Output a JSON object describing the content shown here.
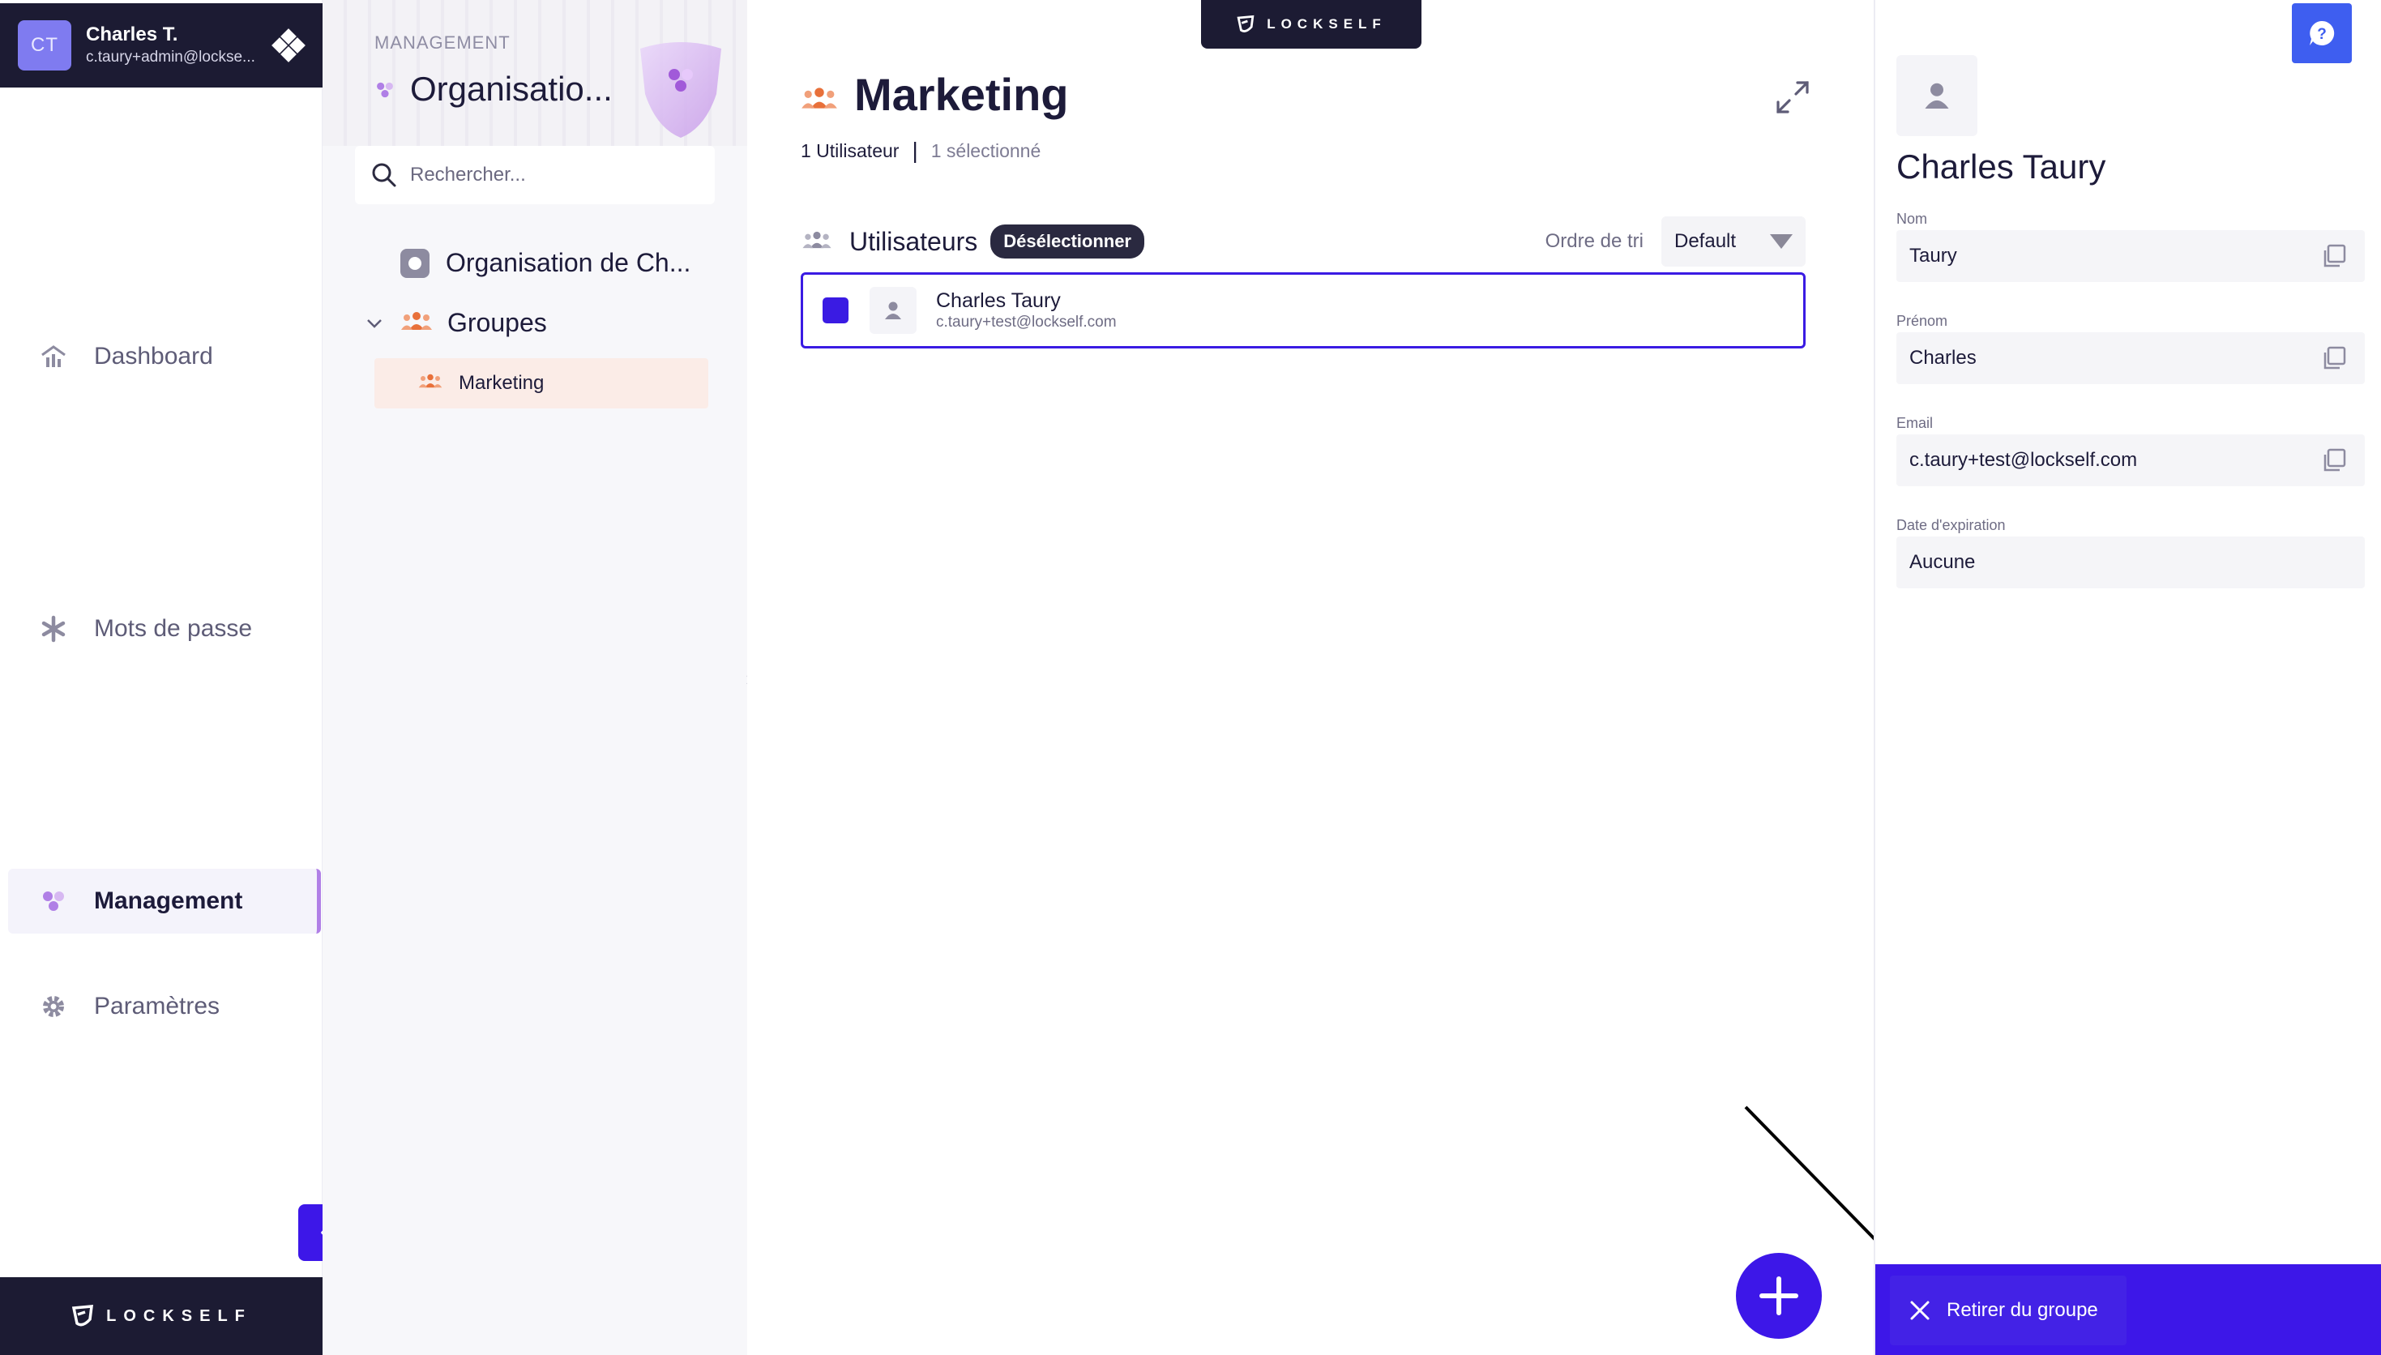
{
  "user": {
    "initials": "CT",
    "name": "Charles T.",
    "email": "c.taury+admin@lockse..."
  },
  "nav": {
    "items": [
      {
        "label": "Dashboard",
        "icon": "dashboard-icon"
      },
      {
        "label": "Mots de passe",
        "icon": "asterisk-icon"
      },
      {
        "label": "Management",
        "icon": "management-icon",
        "active": true
      },
      {
        "label": "Paramètres",
        "icon": "gear-icon"
      }
    ]
  },
  "brand": {
    "name": "LOCKSELF"
  },
  "tree": {
    "kicker": "MANAGEMENT",
    "title": "Organisatio...",
    "search_placeholder": "Rechercher...",
    "organisation": "Organisation de Ch...",
    "groups_label": "Groupes",
    "groups": [
      "Marketing"
    ]
  },
  "main": {
    "title": "Marketing",
    "user_count": "1 Utilisateur",
    "selected_count": "1 sélectionné",
    "section_label": "Utilisateurs",
    "deselect_label": "Désélectionner",
    "sort_label": "Ordre de tri",
    "sort_value": "Default",
    "users": [
      {
        "name": "Charles Taury",
        "email": "c.taury+test@lockself.com",
        "selected": true
      }
    ]
  },
  "detail": {
    "name": "Charles Taury",
    "fields": [
      {
        "label": "Nom",
        "value": "Taury",
        "copyable": true
      },
      {
        "label": "Prénom",
        "value": "Charles",
        "copyable": true
      },
      {
        "label": "Email",
        "value": "c.taury+test@lockself.com",
        "copyable": true
      },
      {
        "label": "Date d'expiration",
        "value": "Aucune",
        "copyable": false
      }
    ],
    "remove_label": "Retirer du groupe"
  },
  "colors": {
    "accent": "#3d17e8",
    "dark": "#1c1b33",
    "group_orange": "#e8703a",
    "management_purple": "#b07fe6",
    "help_blue": "#3e5ef0"
  }
}
